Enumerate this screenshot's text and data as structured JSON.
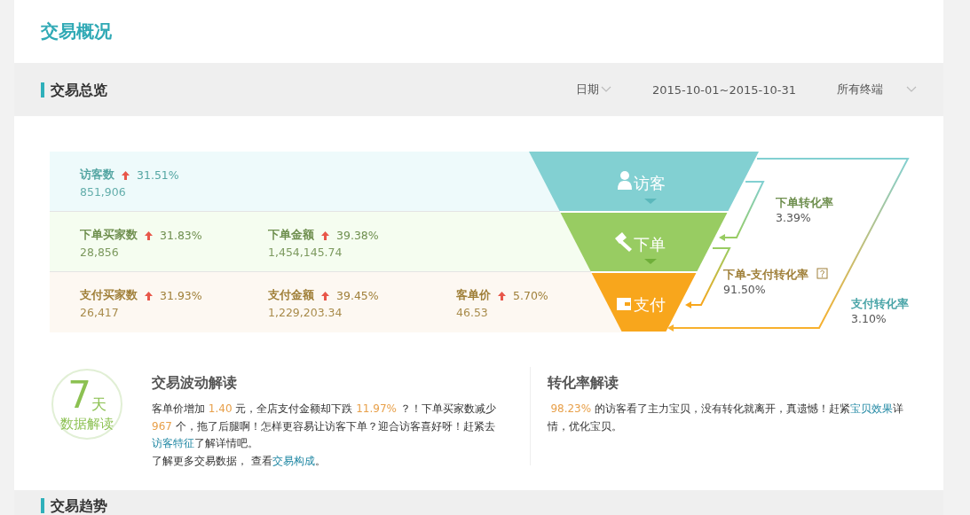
{
  "page_title": "交易概况",
  "overview": {
    "title": "交易总览",
    "filters": [
      {
        "kind": "dropdown",
        "label": "日期"
      },
      {
        "kind": "text",
        "label": "2015-10-01~2015-10-31"
      },
      {
        "kind": "dropdown",
        "label": "所有终端"
      }
    ]
  },
  "funnel": {
    "stages": [
      {
        "kind": "visit",
        "name": "访客",
        "color": "#82d0d2",
        "metrics": [
          {
            "label": "访客数",
            "up": true,
            "change": "31.51%",
            "value": "851,906"
          }
        ]
      },
      {
        "kind": "order",
        "name": "下单",
        "color": "#98cc62",
        "metrics": [
          {
            "label": "下单买家数",
            "up": true,
            "change": "31.83%",
            "value": "28,856"
          },
          {
            "label": "下单金额",
            "up": true,
            "change": "39.38%",
            "value": "1,454,145.74"
          }
        ]
      },
      {
        "kind": "pay",
        "name": "支付",
        "color": "#f8a61c",
        "metrics": [
          {
            "label": "支付买家数",
            "up": true,
            "change": "31.93%",
            "value": "26,417"
          },
          {
            "label": "支付金额",
            "up": true,
            "change": "39.45%",
            "value": "1,229,203.34"
          },
          {
            "label": "客单价",
            "up": true,
            "change": "5.70%",
            "value": "46.53"
          }
        ]
      }
    ],
    "conversions": [
      {
        "label": "下单转化率",
        "value": "3.39%",
        "help": false
      },
      {
        "label": "下单-支付转化率",
        "value": "91.50%",
        "help": true
      },
      {
        "label": "支付转化率",
        "value": "3.10%",
        "help": false
      }
    ]
  },
  "insights": {
    "badge": {
      "number": "7",
      "unit": "天",
      "caption": "数据解读"
    },
    "panels": [
      {
        "title": "交易波动解读",
        "paragraphs": [
          [
            {
              "kind": "text",
              "text": "客单价增加 "
            },
            {
              "kind": "num",
              "text": "1.40"
            },
            {
              "kind": "text",
              "text": " 元，全店支付金额却下跌 "
            },
            {
              "kind": "num",
              "text": "11.97%"
            },
            {
              "kind": "text",
              "text": " ？！下单买家数减少 "
            },
            {
              "kind": "num",
              "text": "967"
            },
            {
              "kind": "text",
              "text": " 个，拖了后腿啊！怎样更容易让访客下单？迎合访客喜好呀！赶紧去"
            },
            {
              "kind": "link",
              "text": "访客特征"
            },
            {
              "kind": "text",
              "text": "了解详情吧。"
            }
          ],
          [
            {
              "kind": "text",
              "text": "了解更多交易数据， 查看"
            },
            {
              "kind": "link",
              "text": "交易构成"
            },
            {
              "kind": "text",
              "text": "。"
            }
          ]
        ]
      },
      {
        "title": "转化率解读",
        "paragraphs": [
          [
            {
              "kind": "num",
              "text": " 98.23%"
            },
            {
              "kind": "text",
              "text": " 的访客看了主力宝贝，没有转化就离开，真遗憾！赶紧"
            },
            {
              "kind": "link",
              "text": "宝贝效果"
            },
            {
              "kind": "text",
              "text": "详情，优化宝贝。"
            }
          ]
        ]
      }
    ]
  },
  "trend_section": {
    "title": "交易趋势"
  }
}
